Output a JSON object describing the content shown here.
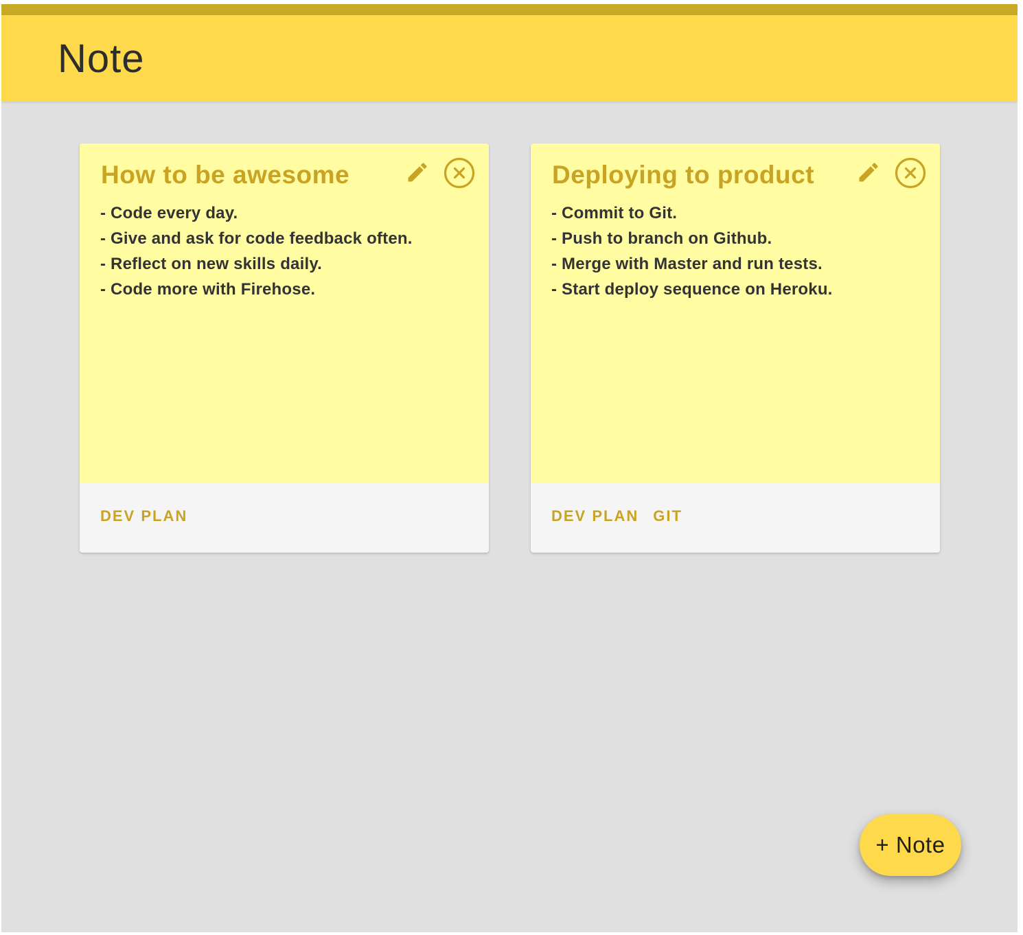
{
  "app": {
    "title": "Note"
  },
  "colors": {
    "header": "#fdd94b",
    "header_strip": "#c9a928",
    "background": "#e0e0e0",
    "note_body": "#fffca2",
    "note_footer": "#f5f5f5",
    "accent_text": "#c9a424",
    "body_text": "#333333"
  },
  "notes": [
    {
      "title": "How to be awesome",
      "lines": [
        "- Code every day.",
        "- Give and ask for code feedback often.",
        "- Reflect on new skills daily.",
        "- Code more with Firehose."
      ],
      "tags": [
        "DEV PLAN"
      ],
      "edit_icon": "pencil-icon",
      "delete_icon": "circle-close-icon"
    },
    {
      "title": "Deploying to product",
      "lines": [
        "- Commit to Git.",
        "- Push to branch on Github.",
        "- Merge with Master and run tests.",
        "- Start deploy sequence on Heroku."
      ],
      "tags": [
        "DEV PLAN",
        "GIT"
      ],
      "edit_icon": "pencil-icon",
      "delete_icon": "circle-close-icon"
    }
  ],
  "fab": {
    "label": "+ Note"
  }
}
